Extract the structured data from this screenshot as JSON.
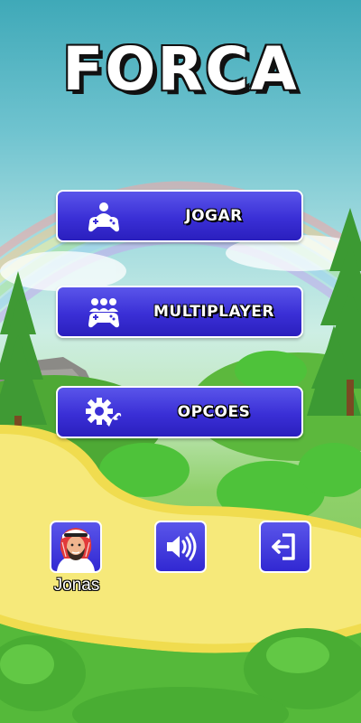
{
  "app": {
    "title": "FORCA"
  },
  "menu": {
    "play_label": "JOGAR",
    "multiplayer_label": "MULTIPLAYER",
    "options_label": "OPCOES"
  },
  "player": {
    "name": "Jonas"
  },
  "icons": {
    "play": "gamepad-single-player-icon",
    "multiplayer": "gamepad-multiplayer-icon",
    "options": "gear-wrench-icon",
    "sound": "speaker-volume-icon",
    "exit": "exit-door-icon",
    "avatar": "avatar-arab-man-icon"
  },
  "colors": {
    "button_blue": "#3a2fd6",
    "button_border": "#ffffff",
    "title": "#ffffff"
  }
}
